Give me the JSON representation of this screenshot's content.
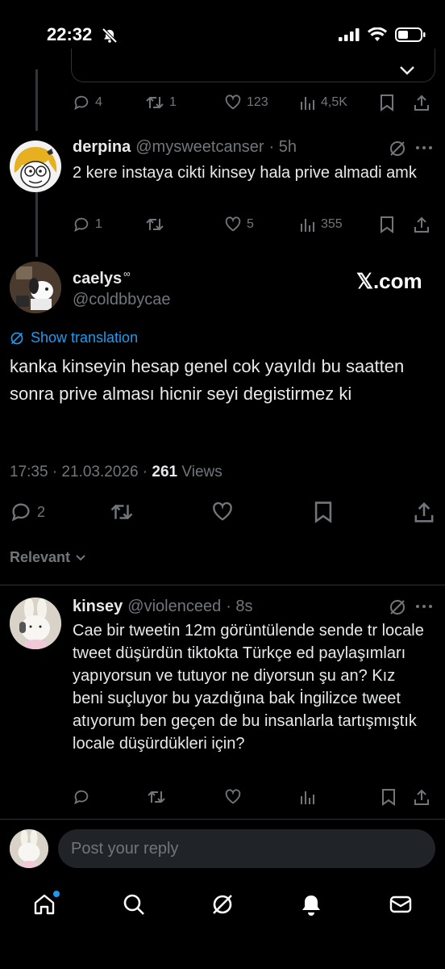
{
  "status_bar": {
    "time": "22:32"
  },
  "top_tweet": {
    "replies": "4",
    "reposts": "1",
    "likes": "123",
    "views": "4,5K"
  },
  "reply1": {
    "name": "derpina",
    "handle": "@mysweetcanser",
    "time": "· 5h",
    "text": "2 kere instaya cikti kinsey hala prive almadi amk",
    "replies": "1",
    "reposts": "",
    "likes": "5",
    "views": "355"
  },
  "main_tweet": {
    "name": "caelys",
    "name_badge": "∞",
    "handle": "@coldbbycae",
    "watermark": "𝕏.com",
    "translate_label": "Show translation",
    "text": "kanka kinseyin hesap genel cok yayıldı bu saatten sonra prive alması hicnir seyi degistirmez ki",
    "timestamp": "17:35 · 21.03.2026 · ",
    "views_count": "261",
    "views_label": " Views",
    "replies": "2"
  },
  "sort": {
    "label": "Relevant"
  },
  "reply2": {
    "name": "kinsey",
    "handle": "@violenceed",
    "time": "· 8s",
    "text": "Cae  bir tweetin 12m görüntülende sende tr locale tweet düşürdün tiktokta Türkçe ed paylaşımları yapıyorsun ve tutuyor ne diyorsun şu an? Kız beni suçluyor bu yazdığına bak İngilizce tweet atıyorum ben geçen de bu insanlarla tartışmıştık locale düşürdükleri için?"
  },
  "reply_box": {
    "placeholder": "Post your reply"
  },
  "colors": {
    "accent": "#1d9bf0",
    "muted": "#71767b",
    "text": "#e7e9ea",
    "bg": "#000000"
  },
  "icons": [
    "reply-icon",
    "repost-icon",
    "like-icon",
    "views-icon",
    "bookmark-icon",
    "share-icon",
    "grok-icon",
    "more-icon",
    "translate-icon",
    "home-icon",
    "search-icon",
    "notifications-icon",
    "messages-icon"
  ]
}
